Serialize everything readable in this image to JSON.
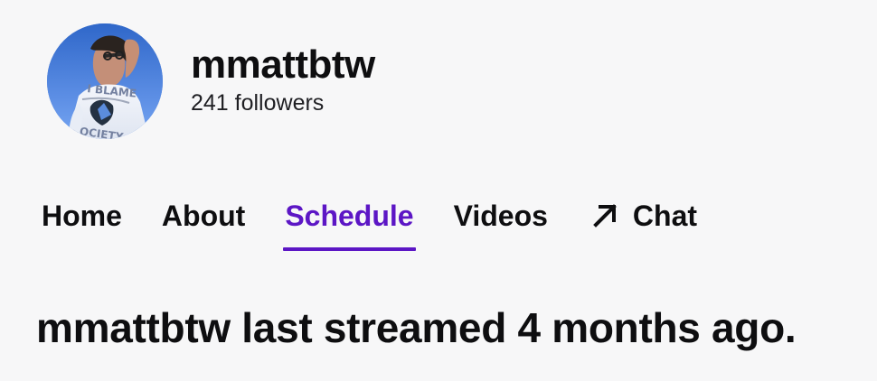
{
  "channel": {
    "name": "mmattbtw",
    "followers": "241 followers",
    "avatar_label": "mmattbtw avatar"
  },
  "nav": {
    "tabs": [
      {
        "label": "Home",
        "active": false
      },
      {
        "label": "About",
        "active": false
      },
      {
        "label": "Schedule",
        "active": true
      },
      {
        "label": "Videos",
        "active": false
      },
      {
        "label": "Chat",
        "active": false,
        "icon": "external-arrow-icon"
      }
    ]
  },
  "status": {
    "last_streamed": "mmattbtw last streamed 4 months ago."
  },
  "colors": {
    "accent": "#5c16c5",
    "background": "#f7f7f8",
    "text": "#0e0e10"
  },
  "avatar_print": {
    "shirt_text_top": "I BLAME",
    "shirt_text_bottom": "SOCIETY"
  }
}
